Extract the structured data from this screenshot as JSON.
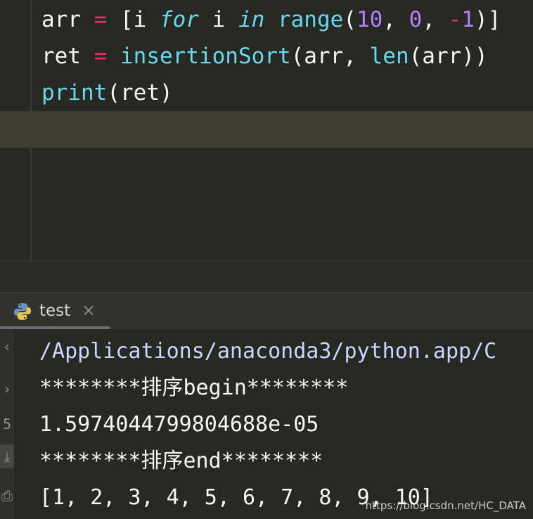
{
  "editor": {
    "line1": {
      "a": "arr ",
      "b": "=",
      "c": " [i ",
      "d": "for",
      "e": " i ",
      "f": "in",
      "g": " ",
      "h": "range",
      "i": "(",
      "j": "10",
      "k": ", ",
      "l": "0",
      "m": ", ",
      "n": "-",
      "o": "1",
      "p": ")]"
    },
    "line2": {
      "a": "ret ",
      "b": "=",
      "c": " ",
      "d": "insertionSort",
      "e": "(arr, ",
      "f": "len",
      "g": "(arr))"
    },
    "line3": {
      "a": "print",
      "b": "(ret)"
    }
  },
  "run_tab": {
    "label": "test",
    "close": "×",
    "icon": "python-icon"
  },
  "toolbar": {
    "up": "‹",
    "down": "›",
    "rerun": "5",
    "download": "⤓",
    "print": "⎙"
  },
  "console": {
    "lines": [
      "/Applications/anaconda3/python.app/C",
      "********排序begin********",
      "1.5974044799804688e-05",
      "********排序end********",
      "[1, 2, 3, 4, 5, 6, 7, 8, 9, 10]"
    ]
  },
  "watermark": "https://blog.csdn.net/HC_DATA",
  "colors": {
    "background": "#272822",
    "keyword": "#66d9ef",
    "operator": "#f92672",
    "number": "#ae81ff"
  }
}
